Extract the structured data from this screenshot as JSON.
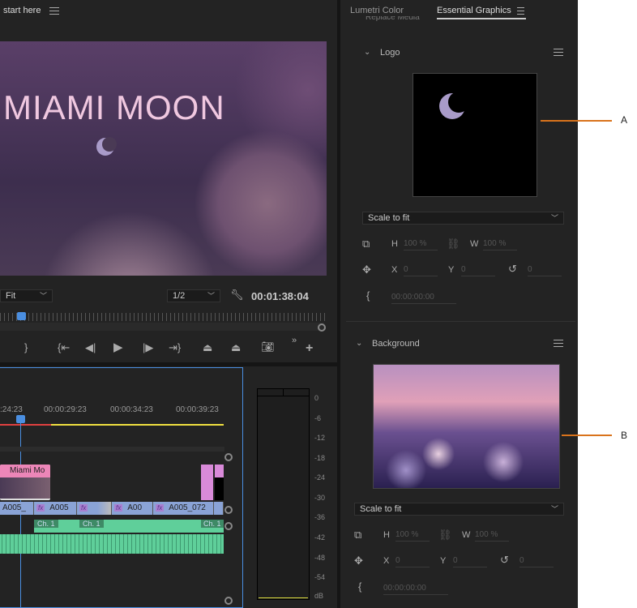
{
  "program_monitor": {
    "tab_label": "start here",
    "video_title": "MIAMI MOON",
    "zoom_select": "Fit",
    "resolution_select": "1/2",
    "timecode": "00:01:38:04"
  },
  "timeline": {
    "ruler_labels": [
      ":24:23",
      "00:00:29:23",
      "00:00:34:23",
      "00:00:39:23"
    ],
    "graphic_clip": "Miami Mo",
    "video_clips": [
      "A005_",
      "A005",
      "",
      "A00",
      "A005_072"
    ],
    "audio_clip_labels": [
      "Ch. 1",
      "Ch. 1",
      "Ch. 1"
    ]
  },
  "audio_meter": {
    "ticks": [
      "0",
      "-6",
      "-12",
      "-18",
      "-24",
      "-30",
      "-36",
      "-42",
      "-48",
      "-54",
      "dB"
    ]
  },
  "panel": {
    "tabs": [
      "Lumetri Color",
      "Essential Graphics"
    ],
    "active_tab": "Essential Graphics",
    "cut_text": "Replace Media",
    "sections": [
      {
        "title": "Logo",
        "scale_mode": "Scale to fit",
        "h": "100 %",
        "w": "100 %",
        "x": "0",
        "y": "0",
        "rotation": "0",
        "time": "00:00:00:00"
      },
      {
        "title": "Background",
        "scale_mode": "Scale to fit",
        "h": "100 %",
        "w": "100 %",
        "x": "0",
        "y": "0",
        "rotation": "0",
        "time": "00:00:00:00"
      }
    ],
    "labels": {
      "h": "H",
      "w": "W",
      "x": "X",
      "y": "Y"
    }
  },
  "callouts": [
    "A",
    "B"
  ],
  "colors": {
    "accent": "#4a8ee0",
    "callout": "#d9731c",
    "logo_pink": "#eaa3cf",
    "logo_lilac": "#a99bc9"
  }
}
